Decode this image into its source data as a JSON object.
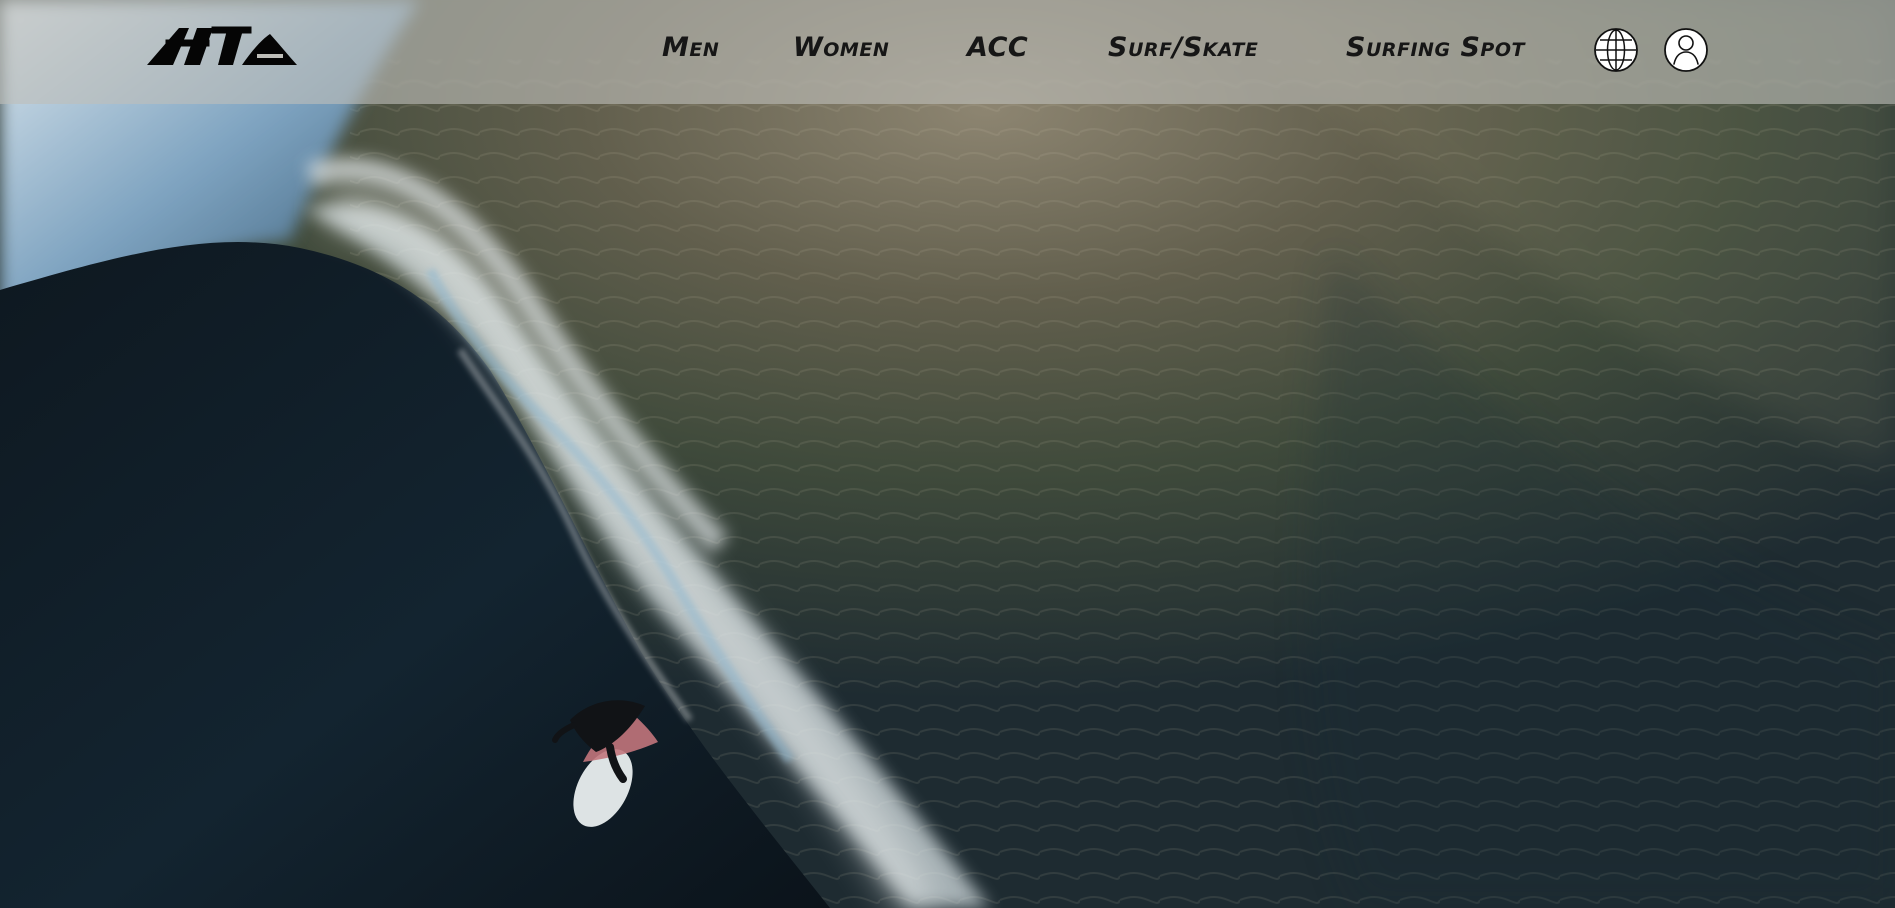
{
  "site": {
    "brand_logo_text": "AtTa"
  },
  "nav": {
    "items": [
      {
        "label": "Men"
      },
      {
        "label": "Women"
      },
      {
        "label": "ACC"
      },
      {
        "label": "Surf/Skate"
      },
      {
        "label": "Surfing Spot"
      }
    ]
  },
  "icons": {
    "language": "globe-icon",
    "account": "user-account-icon"
  },
  "hero": {
    "image": "aerial-surf-wave-icon"
  },
  "colors": {
    "header_overlay": "#bebeb9",
    "nav_text": "#161616",
    "ocean_dark": "#101c25",
    "ocean_mid": "#3f4a3b",
    "foam": "#e9eef0"
  }
}
